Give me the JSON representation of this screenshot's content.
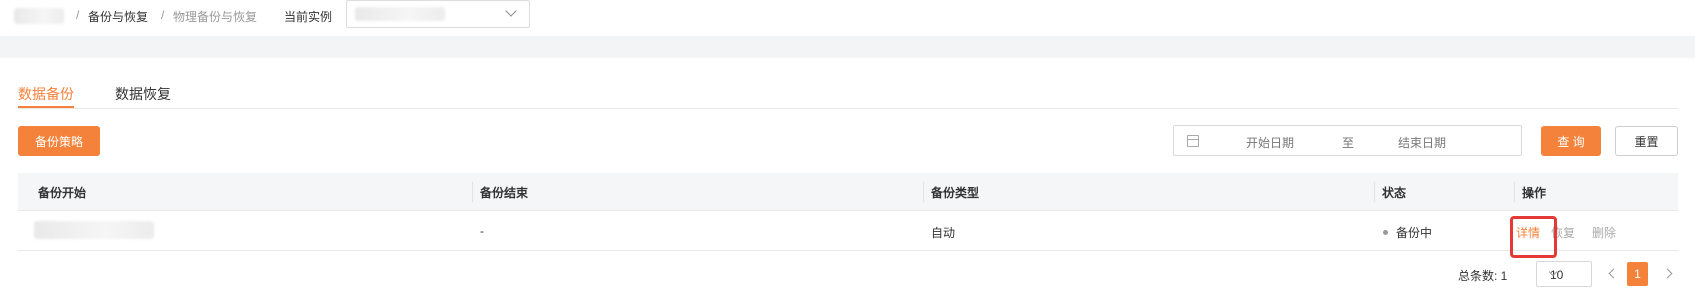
{
  "breadcrumb": {
    "separator": "/",
    "items": [
      "备份与恢复",
      "物理备份与恢复"
    ],
    "instance_label": "当前实例"
  },
  "tabs": [
    "数据备份",
    "数据恢复"
  ],
  "toolbar": {
    "strategy_button": "备份策略",
    "start_date_placeholder": "开始日期",
    "range_separator": "至",
    "end_date_placeholder": "结束日期",
    "query_button": "查 询",
    "reset_button": "重置"
  },
  "table": {
    "columns": [
      "备份开始",
      "备份结束",
      "备份类型",
      "状态",
      "操作"
    ],
    "rows": [
      {
        "end": "-",
        "type": "自动",
        "status": "备份中",
        "actions": [
          "详情",
          "恢复",
          "删除"
        ]
      }
    ]
  },
  "pagination": {
    "total_label": "总条数: 1",
    "page_size": "10",
    "current_page": "1"
  },
  "colors": {
    "accent": "#f5823a",
    "highlight": "#e53935"
  }
}
